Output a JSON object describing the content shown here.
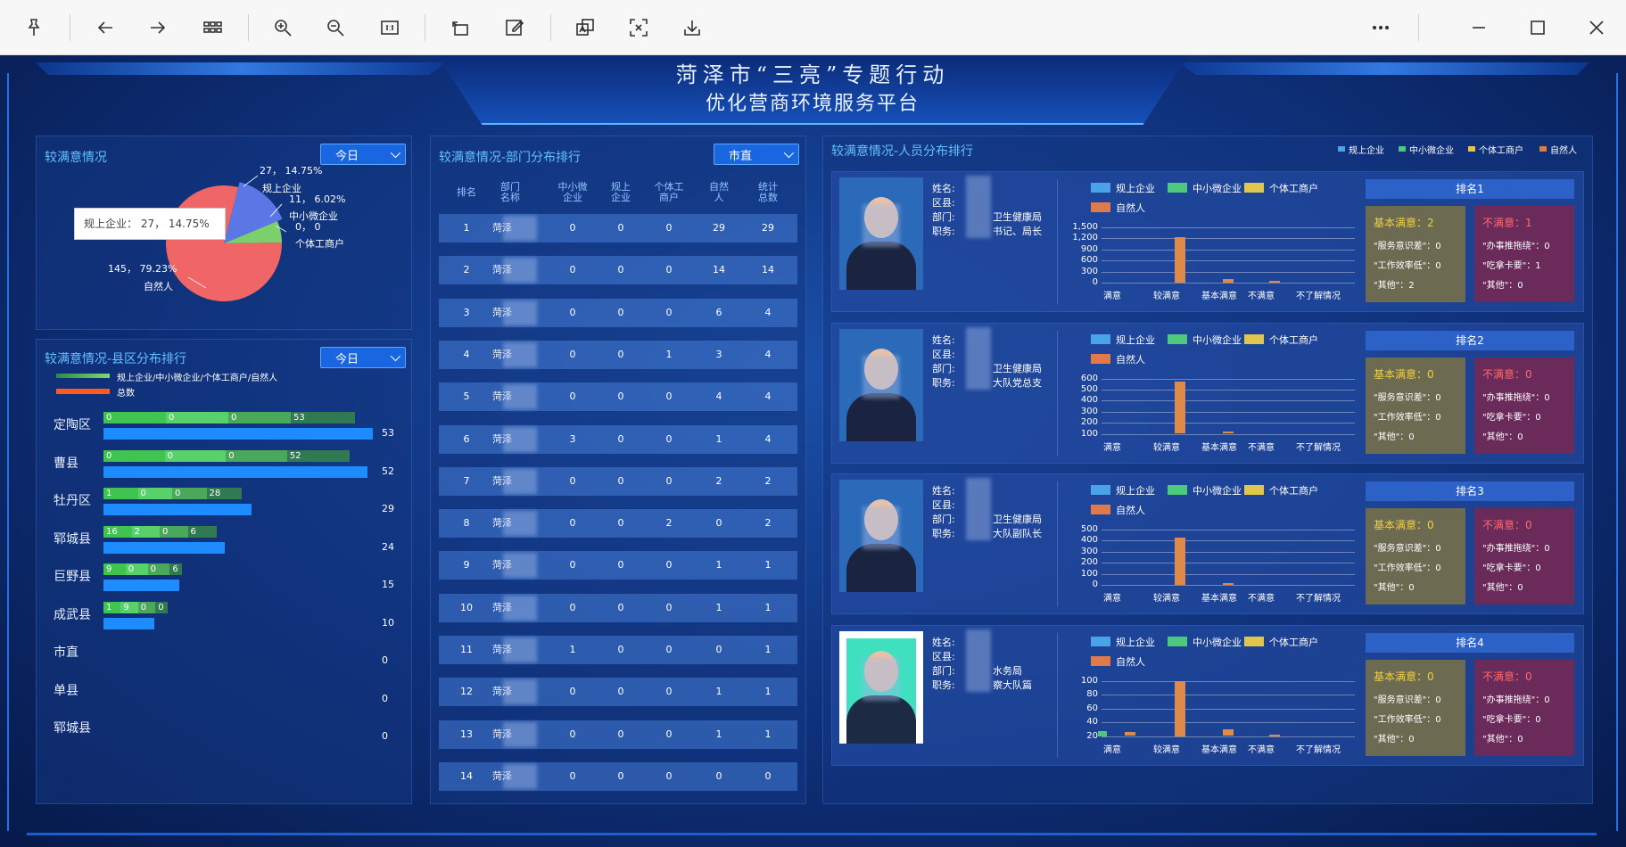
{
  "toolbar": {
    "buttons": [
      "pin-icon",
      "back-icon",
      "forward-icon",
      "grid-icon",
      "zoom-in-icon",
      "zoom-out-icon",
      "actual-size-icon",
      "rotate-icon",
      "edit-icon",
      "translate-icon",
      "ocr-icon",
      "save-icon",
      "more-icon",
      "minimize-icon",
      "maximize-icon",
      "close-icon"
    ]
  },
  "header": {
    "line1": "菏泽市“三亮”专题行动",
    "line2": "优化营商环境服务平台"
  },
  "satisfaction": {
    "title": "较满意情况",
    "dropdown": "今日",
    "tooltip": "规上企业：  27， 14.75%",
    "labels": {
      "a_value": "27， 14.75%",
      "a_name": "规上企业",
      "b_value": "11， 6.02%",
      "b_name": "中小微企业",
      "c_value": "0， 0",
      "c_name": "个体工商户",
      "d_value": "145， 79.23%",
      "d_name": "自然人"
    },
    "colors": {
      "a": "#5b77e6",
      "b": "#7ccf6b",
      "c": "#e8c04a",
      "d": "#f06666"
    },
    "values": [
      27,
      11,
      0,
      145
    ]
  },
  "county": {
    "title": "较满意情况-县区分布排行",
    "dropdown": "今日",
    "legend_segments": "规上企业/中小微企业/个体工商户/自然人",
    "legend_total": "总数",
    "rows": [
      {
        "name": "定陶区",
        "segs": [
          "0",
          "0",
          "0",
          "53"
        ],
        "total": "53",
        "fill": 1.0
      },
      {
        "name": "曹县",
        "segs": [
          "0",
          "0",
          "0",
          "52"
        ],
        "total": "52",
        "fill": 0.98
      },
      {
        "name": "牡丹区",
        "segs": [
          "1",
          "0",
          "0",
          "28"
        ],
        "total": "29",
        "fill": 0.55
      },
      {
        "name": "郓城县",
        "segs": [
          "16",
          "2",
          "0",
          "6"
        ],
        "total": "24",
        "fill": 0.45
      },
      {
        "name": "巨野县",
        "segs": [
          "9",
          "0",
          "0",
          "6"
        ],
        "total": "15",
        "fill": 0.28
      },
      {
        "name": "成武县",
        "segs": [
          "1",
          "9",
          "0",
          "0"
        ],
        "total": "10",
        "fill": 0.19
      },
      {
        "name": "市直",
        "segs": [],
        "total": "0",
        "fill": 0
      },
      {
        "name": "单县",
        "segs": [],
        "total": "0",
        "fill": 0
      },
      {
        "name": "郓城县",
        "segs": [],
        "total": "0",
        "fill": 0
      }
    ]
  },
  "dept": {
    "title": "较满意情况-部门分布排行",
    "dropdown": "市直",
    "headers": [
      "排名",
      "部门\n名称",
      "中小微\n企业",
      "规上\n企业",
      "个体工\n商户",
      "自然\n人",
      "统计\n总数"
    ],
    "rows": [
      [
        "1",
        "菏泽",
        "0",
        "0",
        "0",
        "29",
        "29"
      ],
      [
        "2",
        "菏泽",
        "0",
        "0",
        "0",
        "14",
        "14"
      ],
      [
        "3",
        "菏泽",
        "0",
        "0",
        "0",
        "6",
        "4"
      ],
      [
        "4",
        "菏泽",
        "0",
        "0",
        "1",
        "3",
        "4"
      ],
      [
        "5",
        "菏泽",
        "0",
        "0",
        "0",
        "4",
        "4"
      ],
      [
        "6",
        "菏泽",
        "3",
        "0",
        "0",
        "1",
        "4"
      ],
      [
        "7",
        "菏泽",
        "0",
        "0",
        "0",
        "2",
        "2"
      ],
      [
        "8",
        "菏泽",
        "0",
        "0",
        "2",
        "0",
        "2"
      ],
      [
        "9",
        "菏泽",
        "0",
        "0",
        "0",
        "1",
        "1"
      ],
      [
        "10",
        "菏泽",
        "0",
        "0",
        "0",
        "1",
        "1"
      ],
      [
        "11",
        "菏泽",
        "1",
        "0",
        "0",
        "0",
        "1"
      ],
      [
        "12",
        "菏泽",
        "0",
        "0",
        "0",
        "1",
        "1"
      ],
      [
        "13",
        "菏泽",
        "0",
        "0",
        "0",
        "1",
        "1"
      ],
      [
        "14",
        "菏泽",
        "0",
        "0",
        "0",
        "0",
        "0"
      ]
    ]
  },
  "people": {
    "title": "较满意情况-人员分布排行",
    "legend": [
      "规上企业",
      "中小微企业",
      "个体工商户",
      "自然人"
    ],
    "legend_colors": [
      "#4aa3e8",
      "#4cc97a",
      "#e0c64a",
      "#e07a4a"
    ],
    "field_labels": [
      "姓名:",
      "区县:",
      "部门:",
      "职务:"
    ],
    "x_labels": [
      "满意",
      "较满意",
      "基本满意",
      "不满意",
      "不了解情况"
    ],
    "cards": [
      {
        "rank": "排名1",
        "dept_tail": "卫生健康局",
        "duty_tail": "书记、局长",
        "yticks": [
          "1,500",
          "1,200",
          "900",
          "600",
          "300",
          "0"
        ],
        "basic": "基本满意：2",
        "unsat": "不满意：1",
        "b_lines": [
          "\"服务意识差\"：0",
          "\"工作效率低\"：0",
          "\"其他\"：2"
        ],
        "u_lines": [
          "\"办事推拖绕\"：0",
          "\"吃拿卡要\"：1",
          "\"其他\"：0"
        ],
        "bars": [
          0.0,
          0.83,
          0.06,
          0.01,
          0.0
        ]
      },
      {
        "rank": "排名2",
        "dept_tail": "卫生健康局",
        "duty_tail": "大队党总支",
        "yticks": [
          "600",
          "500",
          "400",
          "300",
          "200",
          "100"
        ],
        "basic": "基本满意：0",
        "unsat": "不满意：0",
        "b_lines": [
          "\"服务意识差\"：0",
          "\"工作效率低\"：0",
          "\"其他\"：0"
        ],
        "u_lines": [
          "\"办事推拖绕\"：0",
          "\"吃拿卡要\"：0",
          "\"其他\"：0"
        ],
        "bars": [
          0.0,
          0.95,
          0.04,
          0.0,
          0.0
        ]
      },
      {
        "rank": "排名3",
        "dept_tail": "卫生健康局",
        "duty_tail": "大队副队长",
        "yticks": [
          "500",
          "400",
          "300",
          "200",
          "100",
          "0"
        ],
        "basic": "基本满意：0",
        "unsat": "不满意：0",
        "b_lines": [
          "\"服务意识差\"：0",
          "\"工作效率低\"：0",
          "\"其他\"：0"
        ],
        "u_lines": [
          "\"办事推拖绕\"：0",
          "\"吃拿卡要\"：0",
          "\"其他\"：0"
        ],
        "bars": [
          0.0,
          0.85,
          0.02,
          0.0,
          0.0
        ]
      },
      {
        "rank": "排名4",
        "dept_tail": "水务局",
        "duty_tail": "察大队篇",
        "yticks": [
          "100",
          "80",
          "60",
          "40",
          "20"
        ],
        "basic": "基本满意：0",
        "unsat": "不满意：0",
        "b_lines": [
          "\"服务意识差\"：0",
          "\"工作效率低\"：0",
          "\"其他\"：0"
        ],
        "u_lines": [
          "\"办事推拖绕\"：0",
          "\"吃拿卡要\"：0",
          "\"其他\"：0"
        ],
        "bars": [
          0.08,
          1.0,
          0.12,
          0.01,
          0.0
        ]
      }
    ]
  }
}
